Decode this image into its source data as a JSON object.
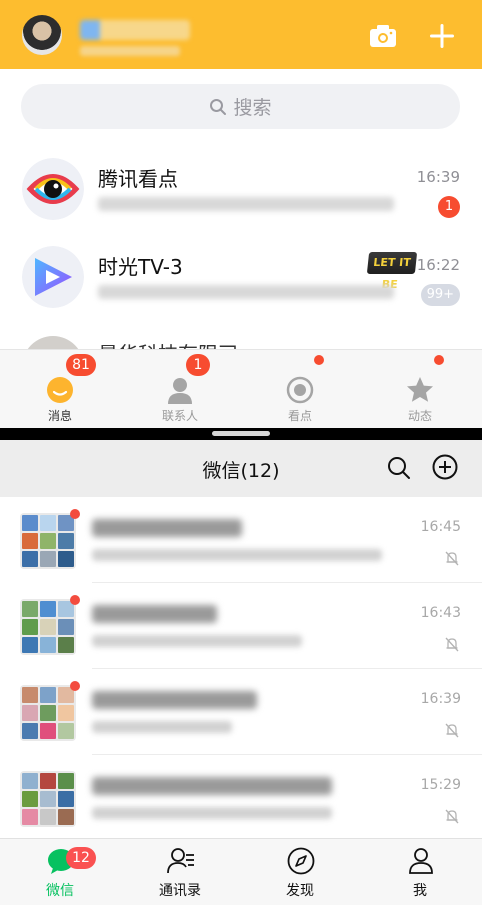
{
  "qq": {
    "header": {
      "camera_icon": "camera-icon",
      "add_icon": "plus-icon",
      "bg_color": "#FDBD2F"
    },
    "search": {
      "label": "搜索"
    },
    "conversations": [
      {
        "title": "腾讯看点",
        "time": "16:39",
        "badge": "1"
      },
      {
        "title": "时光TV-3",
        "time": "16:22",
        "badge": "99+",
        "tag": "LET IT BE"
      },
      {
        "title": "最华科技有限司"
      }
    ],
    "tabs": [
      {
        "label": "消息",
        "badge": "81"
      },
      {
        "label": "联系人",
        "badge": "1"
      },
      {
        "label": "看点"
      },
      {
        "label": "动态"
      }
    ]
  },
  "wechat": {
    "title": "微信(12)",
    "chats": [
      {
        "time": "16:45"
      },
      {
        "time": "16:43"
      },
      {
        "time": "16:39"
      },
      {
        "time": "15:29"
      }
    ],
    "tabs": [
      {
        "label": "微信",
        "badge": "12"
      },
      {
        "label": "通讯录"
      },
      {
        "label": "发现"
      },
      {
        "label": "我"
      }
    ],
    "accent_color": "#07C160"
  }
}
